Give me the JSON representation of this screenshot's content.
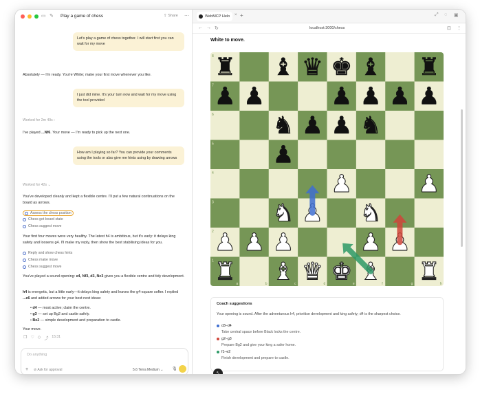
{
  "app": {
    "title": "Play a game of chess",
    "share_label": "Share",
    "traffic_colors": [
      "#ff5f57",
      "#febc2e",
      "#28c840"
    ]
  },
  "chat": {
    "user1": "Let's play a game of chess together. I will start first you can wait for my move",
    "assistant1": "Absolutely — I'm ready. You're White; make your first move whenever you like.",
    "user2": "I just did mine. It's your turn now and wait for my move using the tool provided",
    "worked1": "Worked for 2m 49s",
    "assistant2_prefix": "I've played ",
    "assistant2_move": "...Nf6",
    "assistant2_suffix": ". Your move — I'm ready to pick up the next one.",
    "user3": "How am I playing so far? You can provide your comments using the tools or also give me hints using by drawing arrows",
    "worked2": "Worked for 42s",
    "assistant3": "You've developed cleanly and kept a flexible centre. I'll put a few natural continuations on the board as arrows.",
    "tools1": [
      "Assess the chess position",
      "Chess get board state",
      "Chess suggest move"
    ],
    "assistant4": "Your first four moves were very healthy. The latest h4 is ambitious, but it's early: it delays king safety and loosens g4. I'll make my reply, then show the best stabilising ideas for you.",
    "tools2": [
      "Reply and show chess hints",
      "Chess make move",
      "Chess suggest move"
    ],
    "assistant5_prefix": "You've played a sound opening: ",
    "assistant5_moves": "e4, Nf3, d3, Nc3",
    "assistant5_suffix": " gives you a flexible centre and tidy development.",
    "assistant6_h4": "h4",
    "assistant6_mid": " is energetic, but a little early—it delays king safety and leaves the g4-square softer. I replied ",
    "assistant6_e6": "...e6",
    "assistant6_end": " and added arrows for your best next ideas:",
    "bullets": [
      {
        "move": "d4",
        "text": " — most active; claim the centre."
      },
      {
        "move": "g3",
        "text": " — set up Bg2 and castle safely."
      },
      {
        "move": "Be2",
        "text": " — simple development and preparation to castle."
      }
    ],
    "closing": "Your move.",
    "time": "15:31"
  },
  "composer": {
    "placeholder": "Do anything",
    "approval_label": "Ask for approval",
    "model_label": "5.6 Terra Medium"
  },
  "browser": {
    "tab_title": "WebMCP Helo",
    "url": "localhost:3000/chess"
  },
  "game": {
    "status": "White to move.",
    "light_color": "#eeeed2",
    "dark_color": "#769656",
    "board": [
      [
        "r",
        "",
        "b",
        "q",
        "k",
        "b",
        "",
        "r"
      ],
      [
        "p",
        "p",
        "",
        "",
        "p",
        "p",
        "p",
        "p"
      ],
      [
        "",
        "",
        "n",
        "p",
        "p",
        "n",
        "",
        ""
      ],
      [
        "",
        "",
        "p",
        "",
        "",
        "",
        "",
        ""
      ],
      [
        "",
        "",
        "",
        "",
        "P",
        "",
        "",
        "P"
      ],
      [
        "",
        "",
        "N",
        "P",
        "",
        "N",
        "",
        ""
      ],
      [
        "P",
        "P",
        "P",
        "",
        "",
        "P",
        "P",
        ""
      ],
      [
        "R",
        "",
        "B",
        "Q",
        "K",
        "B",
        "",
        "R"
      ]
    ],
    "ranks": [
      "8",
      "7",
      "6",
      "5",
      "4",
      "3",
      "2",
      "1"
    ],
    "files": [
      "a",
      "b",
      "c",
      "d",
      "e",
      "f",
      "g",
      "h"
    ],
    "arrows": [
      {
        "from": "d3",
        "to": "d4",
        "color": "#3f6fd1"
      },
      {
        "from": "g2",
        "to": "g3",
        "color": "#d0463a"
      },
      {
        "from": "f1",
        "to": "e2",
        "color": "#2e9a67"
      }
    ]
  },
  "coach": {
    "title": "Coach suggestions",
    "intro": "Your opening is sound. After the adventurous h4, prioritise development and king safety; d4 is the sharpest choice.",
    "suggestions": [
      {
        "move": "d3–d4",
        "desc": "Take central space before Black locks the centre.",
        "color": "#3f6fd1"
      },
      {
        "move": "g2–g3",
        "desc": "Prepare Bg2 and give your king a safer home.",
        "color": "#d0463a"
      },
      {
        "move": "f1–e2",
        "desc": "Finish development and prepare to castle.",
        "color": "#2e9a67"
      }
    ]
  }
}
